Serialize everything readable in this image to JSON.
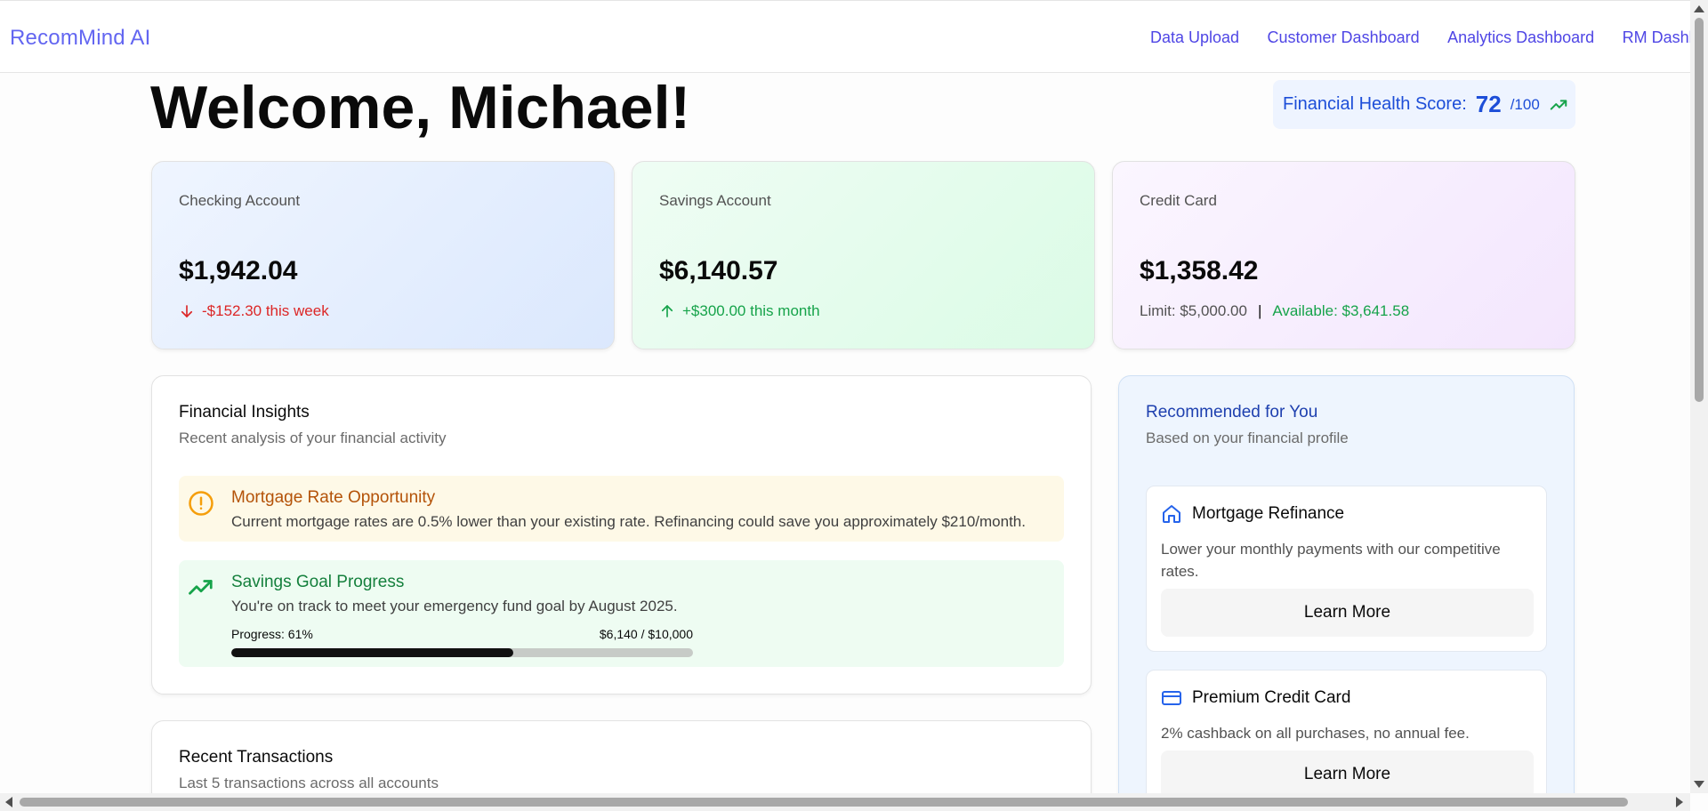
{
  "brand": "RecomMind AI",
  "nav": [
    "Data Upload",
    "Customer Dashboard",
    "Analytics Dashboard",
    "RM Dashboard"
  ],
  "header": {
    "welcome": "Welcome, Michael!",
    "health_label": "Financial Health Score:",
    "health_score": "72",
    "health_max": "/100"
  },
  "accounts": {
    "checking": {
      "title": "Checking Account",
      "amount": "$1,942.04",
      "change": "-$152.30 this week"
    },
    "savings": {
      "title": "Savings Account",
      "amount": "$6,140.57",
      "change": "+$300.00 this month"
    },
    "credit": {
      "title": "Credit Card",
      "amount": "$1,358.42",
      "limit": "Limit: $5,000.00",
      "separator": "|",
      "available": "Available: $3,641.58"
    }
  },
  "insights": {
    "title": "Financial Insights",
    "subtitle": "Recent analysis of your financial activity",
    "mortgage": {
      "title": "Mortgage Rate Opportunity",
      "desc": "Current mortgage rates are 0.5% lower than your existing rate. Refinancing could save you approximately $210/month."
    },
    "savings_goal": {
      "title": "Savings Goal Progress",
      "desc": "You're on track to meet your emergency fund goal by August 2025.",
      "progress_label": "Progress: 61%",
      "progress_amount": "$6,140 / $10,000",
      "progress_fraction": 0.61
    }
  },
  "transactions": {
    "title": "Recent Transactions",
    "subtitle": "Last 5 transactions across all accounts"
  },
  "recommended": {
    "title": "Recommended for You",
    "subtitle": "Based on your financial profile",
    "items": [
      {
        "title": "Mortgage Refinance",
        "desc": "Lower your monthly payments with our competitive rates.",
        "button": "Learn More",
        "icon": "home-icon"
      },
      {
        "title": "Premium Credit Card",
        "desc": "2% cashback on all purchases, no annual fee.",
        "button": "Learn More",
        "icon": "credit-card-icon"
      }
    ]
  },
  "colors": {
    "brand": "#6366f1",
    "negative": "#dc2626",
    "positive": "#16a34a",
    "warning": "#b45309",
    "accent_blue": "#1d4ed8"
  }
}
